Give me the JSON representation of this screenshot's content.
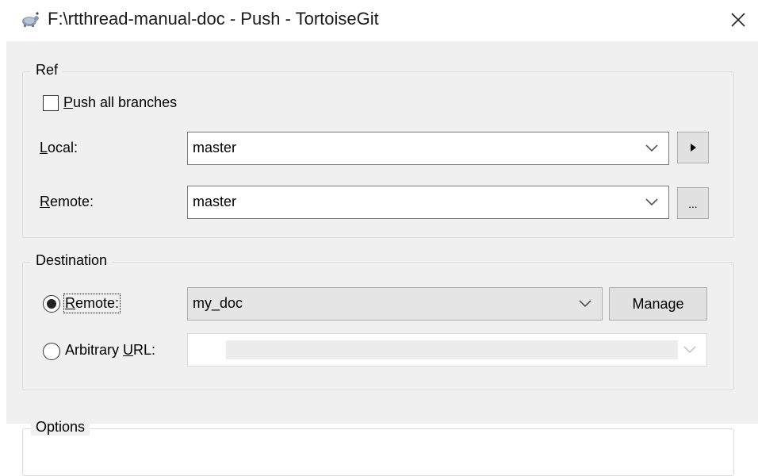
{
  "window": {
    "title": "F:\\rtthread-manual-doc - Push - TortoiseGit",
    "app_icon": "tortoise-icon",
    "close_icon": "close-icon"
  },
  "ref": {
    "legend": "Ref",
    "push_all_branches": {
      "prefix": "",
      "accel": "P",
      "rest": "ush all branches",
      "checked": false
    },
    "local": {
      "accel": "L",
      "rest": "ocal:",
      "value": "master"
    },
    "remote": {
      "accel": "R",
      "rest": "emote:",
      "value": "master"
    },
    "local_button": "▸",
    "remote_button": "..."
  },
  "destination": {
    "legend": "Destination",
    "remote_radio": {
      "accel": "R",
      "rest": "emote:",
      "selected": true
    },
    "remote_value": "my_doc",
    "manage_button": {
      "pre": "Mana",
      "accel": "g",
      "post": "e"
    },
    "arbitrary_radio": {
      "pre": "Arbitrary ",
      "accel": "U",
      "post": "RL:",
      "selected": false
    },
    "arbitrary_value": ""
  },
  "options": {
    "legend": "Options"
  }
}
